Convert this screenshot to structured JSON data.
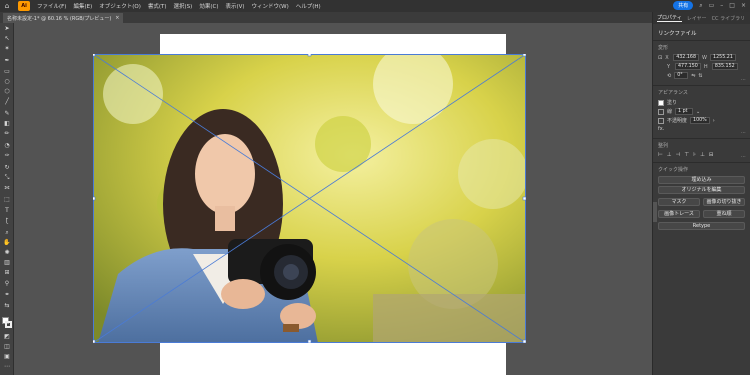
{
  "menubar": {
    "logo": "Ai",
    "items": [
      "ファイル(F)",
      "編集(E)",
      "オブジェクト(O)",
      "書式(T)",
      "選択(S)",
      "効果(C)",
      "表示(V)",
      "ウィンドウ(W)",
      "ヘルプ(H)"
    ],
    "share_label": "共有"
  },
  "document": {
    "tab_title": "名称未設定-1* @ 60.16 % (RGB/プレビュー)",
    "close_glyph": "×"
  },
  "panel": {
    "tabs": [
      "プロパティ",
      "レイヤー",
      "CC ライブラリ"
    ],
    "selection_title": "リンクファイル",
    "transform": {
      "heading": "変形",
      "x_label": "X",
      "x_value": "432.168",
      "y_label": "Y",
      "y_value": "477.150",
      "w_label": "W",
      "w_value": "1255.21",
      "h_label": "H",
      "h_value": "835.152",
      "rotation": "0°"
    },
    "appearance": {
      "heading": "アピアランス",
      "fill_label": "塗り",
      "stroke_label": "線",
      "stroke_weight": "1 pt",
      "opacity_label": "不透明度",
      "opacity_value": "100%",
      "fx_label": "fx."
    },
    "align": {
      "heading": "整列"
    },
    "quick_actions": {
      "heading": "クイック操作",
      "embed": "埋め込み",
      "edit_original": "オリジナルを編集",
      "mask": "マスク",
      "crop": "画像の切り抜き",
      "image_trace": "画像トレース",
      "arrange": "重ね順",
      "retype": "Retype"
    }
  },
  "colors": {
    "accent": "#1473e6",
    "selection": "#4a7bd6"
  }
}
